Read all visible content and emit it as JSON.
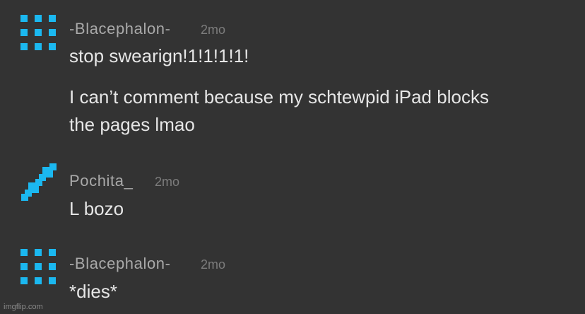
{
  "theme": {
    "background": "#333333",
    "avatar_color": "#1bb8f0"
  },
  "comments": [
    {
      "username": "-Blacephalon-",
      "time": "2mo",
      "avatar_icon": "dot-grid-icon",
      "lines": [
        "stop swearign!1!1!1!1!",
        "I can’t comment because my schtewpid iPad blocks",
        "the pages lmao"
      ]
    },
    {
      "username": "Pochita_",
      "time": "2mo",
      "avatar_icon": "pixel-diagonal-icon",
      "lines": [
        "L bozo"
      ]
    },
    {
      "username": "-Blacephalon-",
      "time": "2mo",
      "avatar_icon": "dot-grid-icon",
      "lines": [
        "*dies*"
      ]
    }
  ],
  "watermark": "imgflip.com"
}
